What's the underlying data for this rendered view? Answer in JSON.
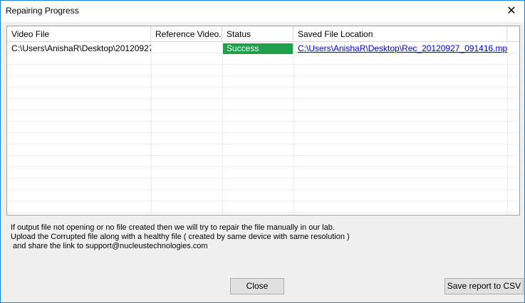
{
  "window": {
    "title": "Repairing Progress"
  },
  "grid": {
    "columns": [
      "Video File",
      "Reference Video...",
      "Status",
      "Saved File Location"
    ],
    "rows": [
      {
        "video_file": "C:\\Users\\AnishaR\\Desktop\\20120927...",
        "reference_video": "",
        "status": "Success",
        "saved_location": "C:\\Users\\AnishaR\\Desktop\\Rec_20120927_091416.mp4\\"
      }
    ],
    "status_color": "#21a04b"
  },
  "info": {
    "line1": "If output file not opening or no file created then we will try to repair the file manually in our lab.",
    "line2": "Upload the Corrupted file along with a healthy file ( created by same device with same resolution )",
    "line3": " and share the link to support@nucleustechnologies.com"
  },
  "buttons": {
    "close": "Close",
    "save_csv": "Save report to CSV"
  }
}
